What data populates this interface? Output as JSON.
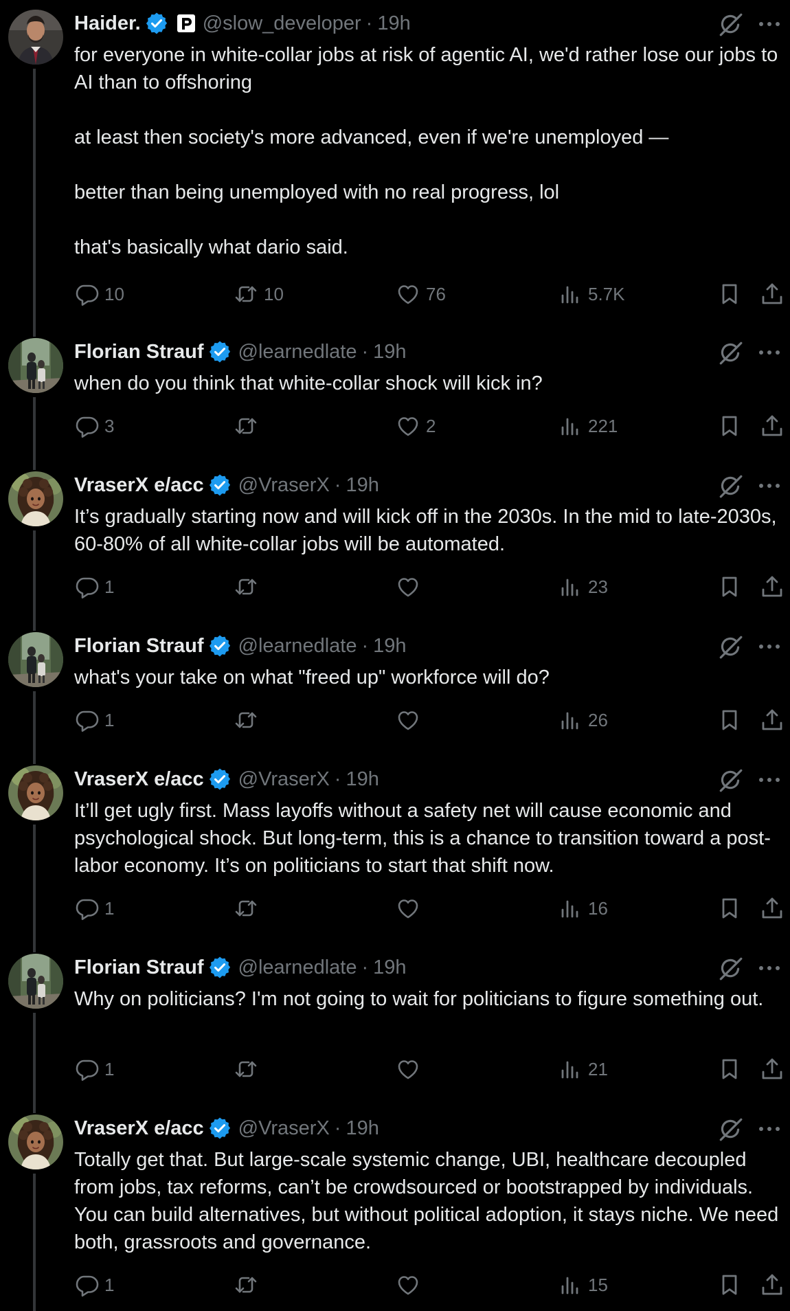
{
  "tweets": [
    {
      "name": "Haider.",
      "handle": "@slow_developer",
      "time": "19h",
      "has_p_badge": true,
      "avatar": "man-in-suit",
      "paragraphs": [
        "for everyone in white-collar jobs at risk of agentic AI, we'd rather lose our jobs to AI than to offshoring",
        "at least then society's more advanced, even if we're unemployed —",
        "better than being unemployed with no real progress, lol",
        "that's basically what dario said."
      ],
      "replies": "10",
      "reposts": "10",
      "likes": "76",
      "views": "5.7K"
    },
    {
      "name": "Florian Strauf",
      "handle": "@learnedlate",
      "time": "19h",
      "avatar": "forest-walk",
      "paragraphs": [
        "when do you think that white-collar shock will kick in?"
      ],
      "replies": "3",
      "reposts": "",
      "likes": "2",
      "views": "221"
    },
    {
      "name": "VraserX e/acc",
      "handle": "@VraserX",
      "time": "19h",
      "avatar": "illustrated-woman",
      "paragraphs": [
        "It’s gradually starting now and will kick off in the 2030s. In the mid to late-2030s, 60-80% of all white-collar jobs will be automated."
      ],
      "replies": "1",
      "reposts": "",
      "likes": "",
      "views": "23"
    },
    {
      "name": "Florian Strauf",
      "handle": "@learnedlate",
      "time": "19h",
      "avatar": "forest-walk",
      "paragraphs": [
        "what's your take on what \"freed up\" workforce will do?"
      ],
      "replies": "1",
      "reposts": "",
      "likes": "",
      "views": "26"
    },
    {
      "name": "VraserX e/acc",
      "handle": "@VraserX",
      "time": "19h",
      "avatar": "illustrated-woman",
      "paragraphs": [
        "It’ll get ugly first. Mass layoffs without a safety net will cause economic and psychological shock. But long-term, this is a chance to transition toward a post-labor economy. It’s on politicians to start that shift now."
      ],
      "replies": "1",
      "reposts": "",
      "likes": "",
      "views": "16"
    },
    {
      "name": "Florian Strauf",
      "handle": "@learnedlate",
      "time": "19h",
      "avatar": "forest-walk",
      "paragraphs": [
        "Why on politicians? I'm not going to wait for politicians to figure something out."
      ],
      "replies": "1",
      "reposts": "",
      "likes": "",
      "views": "21"
    },
    {
      "name": "VraserX e/acc",
      "handle": "@VraserX",
      "time": "19h",
      "avatar": "illustrated-woman",
      "paragraphs": [
        "Totally get that. But large-scale systemic change, UBI, healthcare decoupled from jobs, tax reforms, can’t be crowdsourced or bootstrapped by individuals. You can build alternatives, but without political adoption, it stays niche. We need both, grassroots and governance."
      ],
      "replies": "1",
      "reposts": "",
      "likes": "",
      "views": "15"
    }
  ],
  "icons": {
    "reply": "reply-icon",
    "repost": "repost-icon",
    "like": "heart-icon",
    "views": "views-icon",
    "bookmark": "bookmark-icon",
    "share": "share-icon",
    "grok": "grok-icon",
    "more": "more-icon",
    "verified": "verified-badge-icon",
    "affiliate": "p-affiliate-icon"
  },
  "colors": {
    "background": "#000000",
    "text": "#e7e9ea",
    "secondary": "#71767b",
    "verified": "#1d9bf0",
    "thread_line": "#333639"
  }
}
